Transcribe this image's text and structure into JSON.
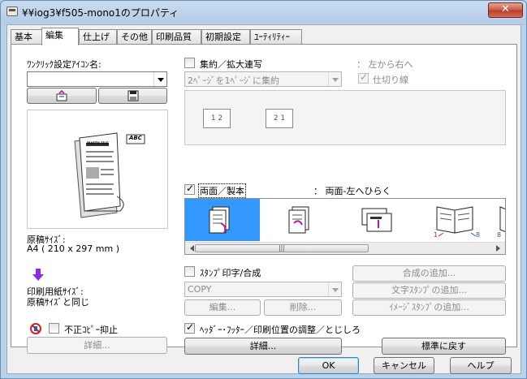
{
  "window": {
    "title": "¥¥iog3¥f505-mono1のプロパティ",
    "close_label": "✕"
  },
  "tabs": [
    {
      "label": "基本"
    },
    {
      "label": "編集"
    },
    {
      "label": "仕上げ"
    },
    {
      "label": "その他"
    },
    {
      "label": "印刷品質"
    },
    {
      "label": "初期設定"
    },
    {
      "label": "ﾕｰﾃｨﾘﾃｨｰ"
    }
  ],
  "left_panel": {
    "one_click_label": "ﾜﾝｸﾘｯｸ設定ｱｲｺﾝ名:",
    "one_click_value": "",
    "original_size_label": "原稿ｻｲｽﾞ:",
    "original_size_value": "A4 ( 210 x 297 mm )",
    "print_paper_label": "印刷用紙ｻｲｽﾞ:",
    "print_paper_value": "原稿ｻｲｽﾞと同じ",
    "preview_tag": "ABC",
    "preview_heading": "PHOTO FILE",
    "copy_protect_label": "不正ｺﾋﾟｰ抑止",
    "detail_button": "詳細..."
  },
  "nup": {
    "label": "集約／拡大連写",
    "direction_label": "：  左から右へ",
    "select_value": "2ﾍﾟｰｼﾞを1ﾍﾟｰｼﾞに集約",
    "separator_label": "仕切り線",
    "page_a": "1 2",
    "page_b": "2 1"
  },
  "duplex": {
    "label": "両面／製本",
    "value": "：  両面-左へひらく",
    "marks": [
      "1",
      "8",
      "8"
    ]
  },
  "stamp": {
    "label": "ｽﾀﾝﾌﾟ印字/合成",
    "select_value": "COPY",
    "edit_button": "編集...",
    "delete_button": "削除...",
    "add_composite_button": "合成の追加...",
    "add_text_stamp_button": "文字ｽﾀﾝﾌﾟの追加...",
    "add_image_stamp_button": "ｲﾒｰｼﾞｽﾀﾝﾌﾟの追加..."
  },
  "header_footer": {
    "label": "ﾍｯﾀﾞｰ･ﾌｯﾀｰ／印刷位置の調整／とじしろ",
    "detail_button": "詳細...",
    "reset_button": "標準に戻す"
  },
  "footer": {
    "ok": "OK",
    "cancel": "キャンセル",
    "help": "ヘルプ"
  },
  "colors": {
    "selection": "#3399ff",
    "accent_purple": "#8b2be2"
  },
  "icons": [
    "printer-icon",
    "stamp-icon",
    "save-disk-icon",
    "arrow-down-icon",
    "copy-protect-icon",
    "booklet-icon"
  ]
}
